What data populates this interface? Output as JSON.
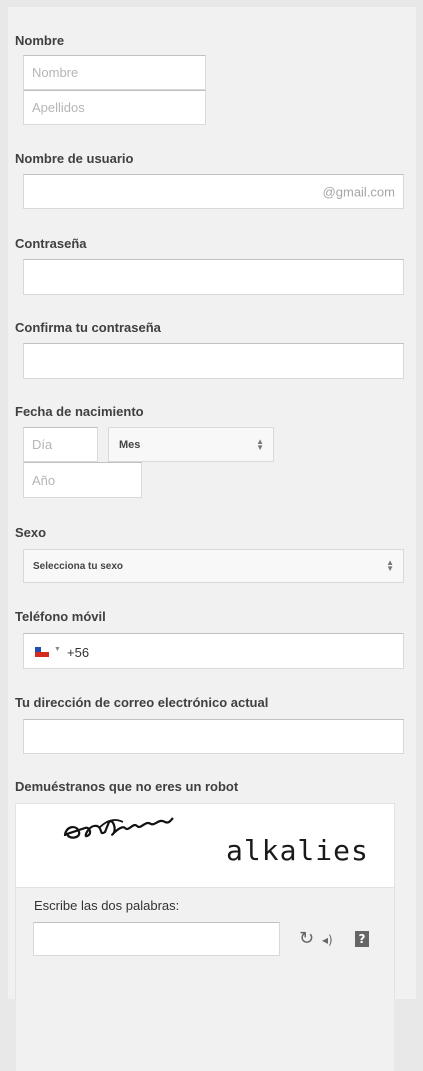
{
  "name": {
    "label": "Nombre",
    "first_placeholder": "Nombre",
    "last_placeholder": "Apellidos"
  },
  "username": {
    "label": "Nombre de usuario",
    "suffix": "@gmail.com"
  },
  "password": {
    "label": "Contraseña"
  },
  "confirm_password": {
    "label": "Confirma tu contraseña"
  },
  "birthdate": {
    "label": "Fecha de nacimiento",
    "day_placeholder": "Día",
    "month_selected": "Mes",
    "year_placeholder": "Año"
  },
  "gender": {
    "label": "Sexo",
    "selected": "Selecciona tu sexo"
  },
  "mobile": {
    "label": "Teléfono móvil",
    "country_code": "+56"
  },
  "current_email": {
    "label": "Tu dirección de correo electrónico actual"
  },
  "captcha": {
    "label": "Demuéstranos que no eres un robot",
    "word1": "eclipsed",
    "word2": "alkalies",
    "prompt": "Escribe las dos palabras:",
    "refresh_icon": "↻",
    "audio_icon": "◂)",
    "help_icon": "?"
  },
  "colors": {
    "panel": "#f1f1f1",
    "field_border": "#d9d9d9",
    "label_text": "#404040",
    "placeholder_text": "#b5b5b5"
  }
}
